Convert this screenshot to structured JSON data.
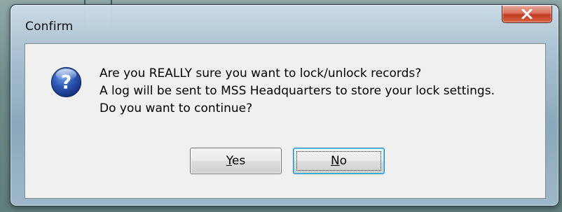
{
  "dialog": {
    "title": "Confirm",
    "close_icon": "close-icon",
    "close_button_color": "#c84a30"
  },
  "message": {
    "icon": "question-icon",
    "icon_color": "#2a56b4",
    "lines": [
      "Are you REALLY sure you want to lock/unlock records?",
      "A log will be sent to MSS Headquarters to store your lock settings.",
      "Do you want to continue?"
    ]
  },
  "buttons": {
    "yes": {
      "mnemonic": "Y",
      "rest": "es",
      "default": false
    },
    "no": {
      "mnemonic": "N",
      "rest": "o",
      "default": true
    }
  }
}
